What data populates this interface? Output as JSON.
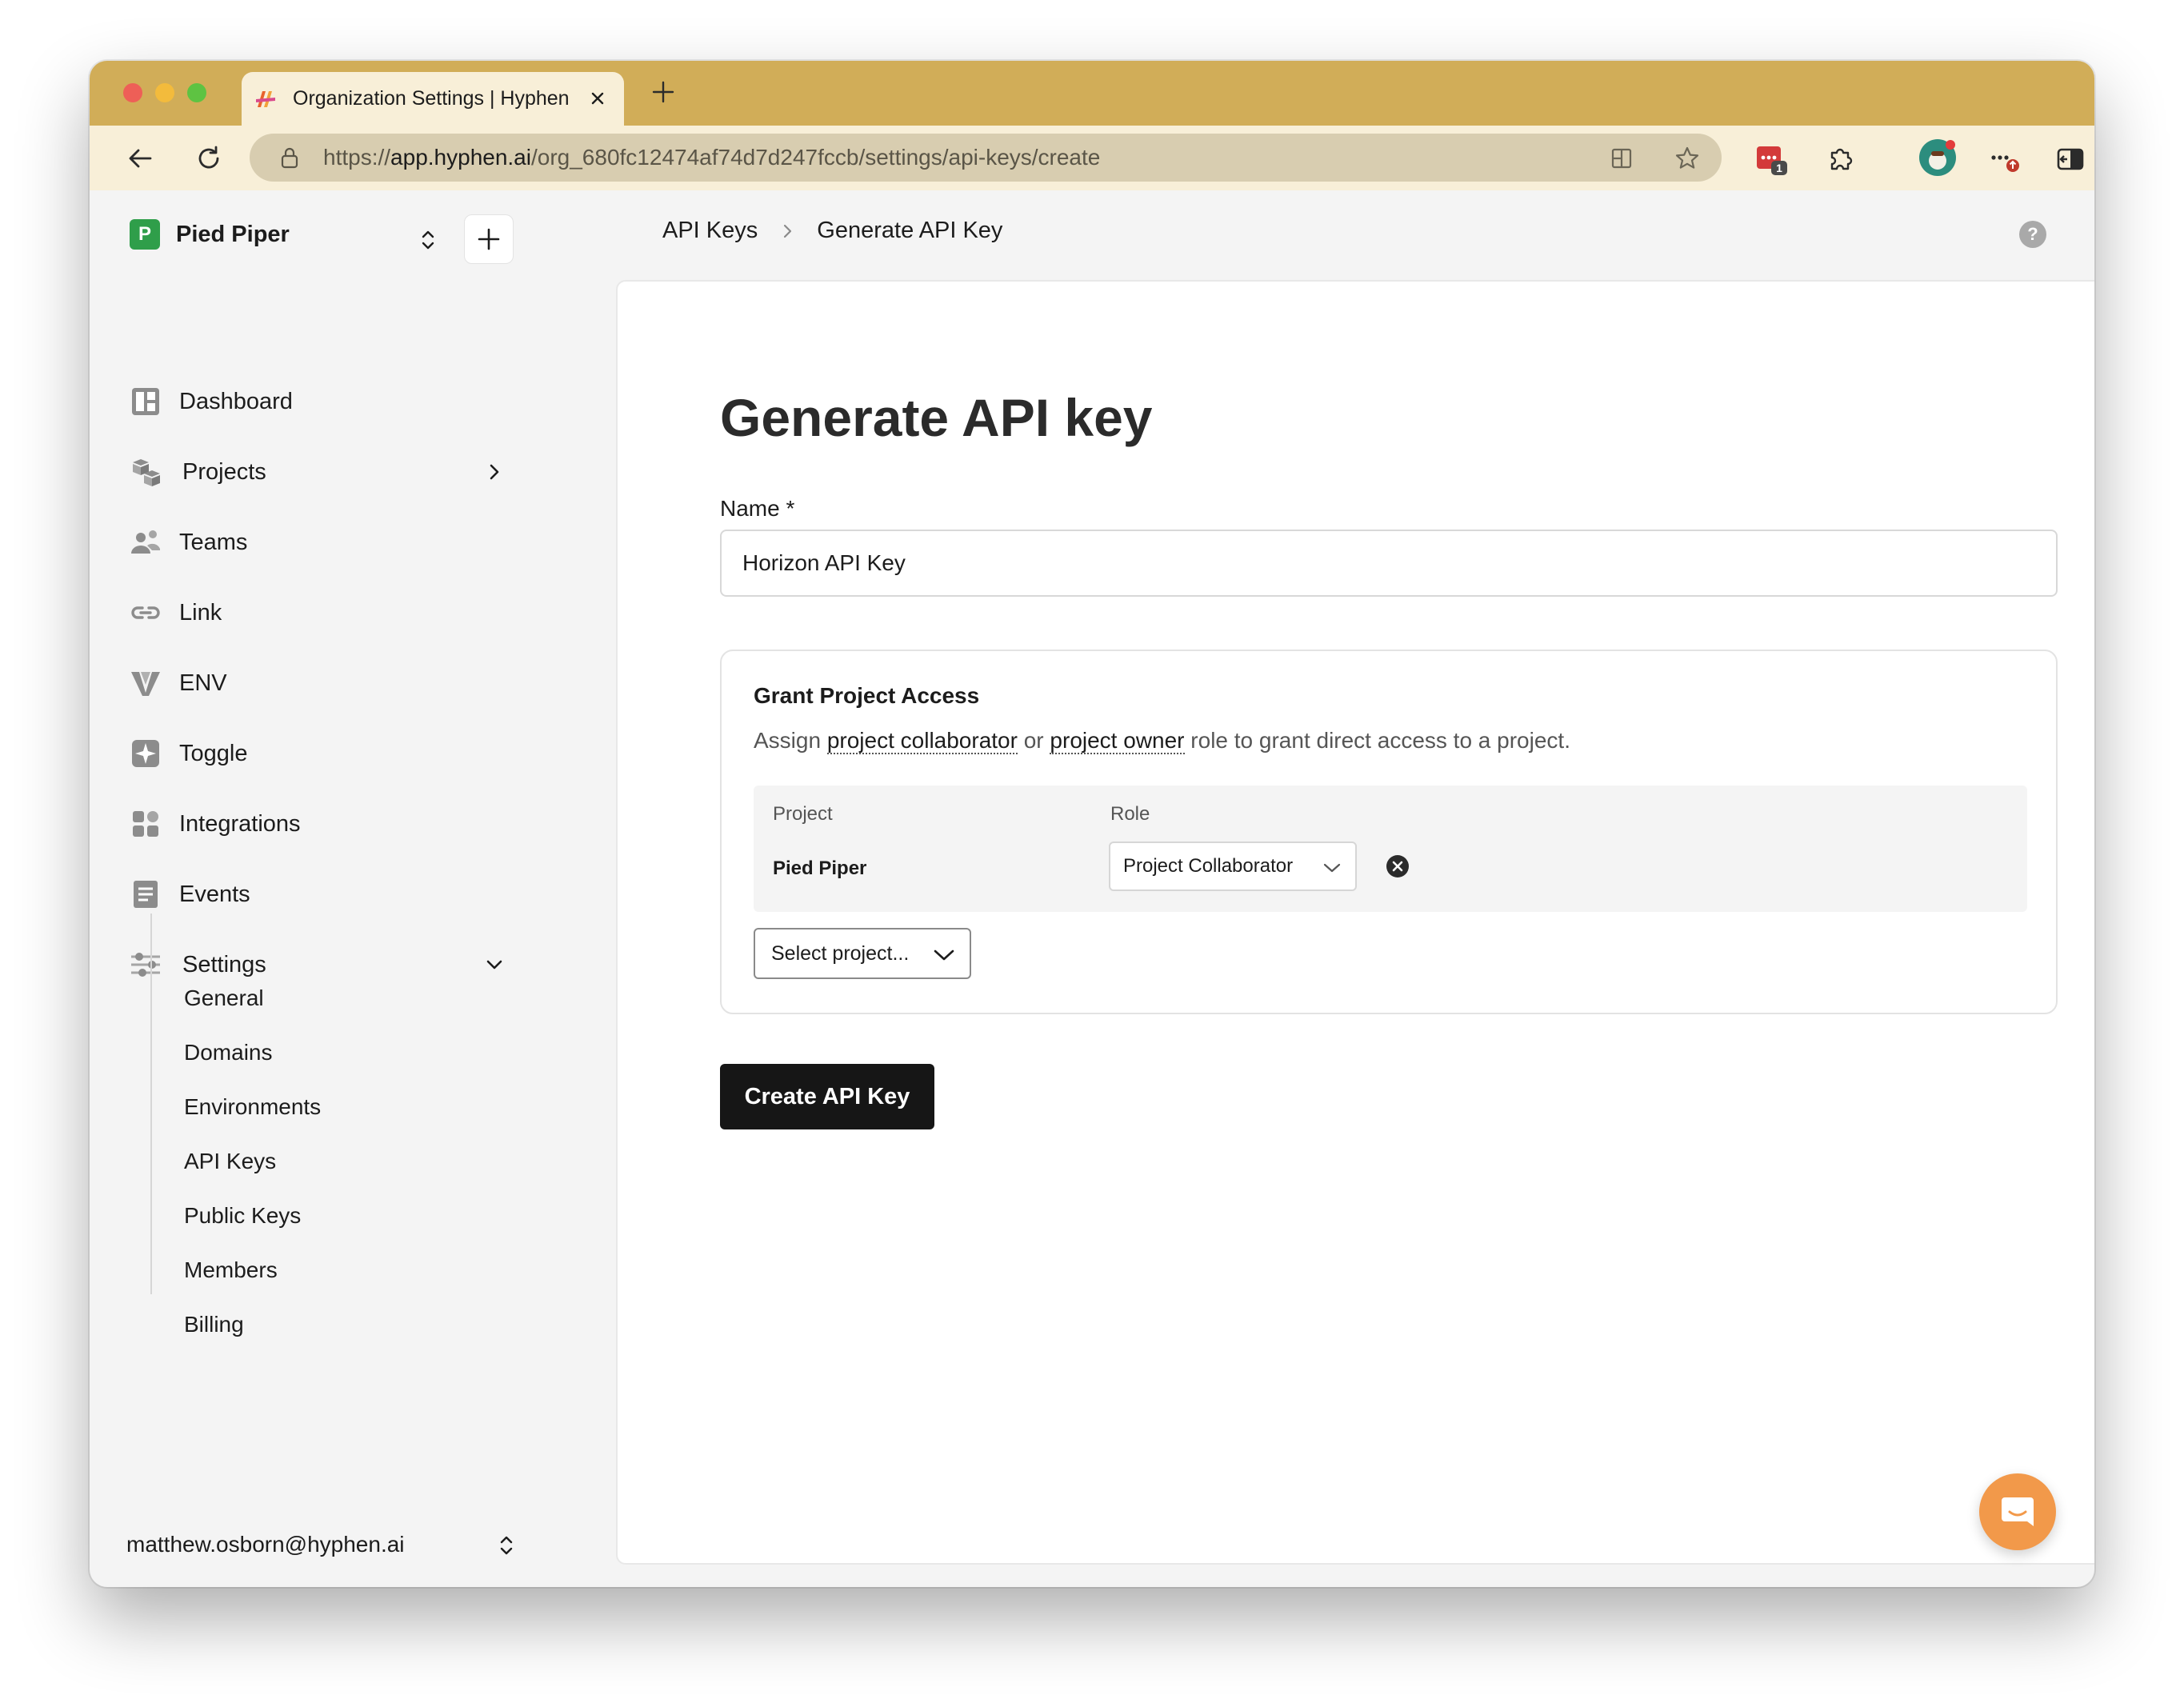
{
  "browser": {
    "tab_title": "Organization Settings | Hyphen",
    "url_prefix": "https://",
    "url_host": "app.hyphen.ai",
    "url_path": "/org_680fc12474af74d7d247fccb/settings/api-keys/create",
    "extension_badge": "1"
  },
  "sidebar": {
    "org_name": "Pied Piper",
    "org_logo_letter": "P",
    "items": [
      {
        "label": "Dashboard",
        "icon": "dashboard-icon"
      },
      {
        "label": "Projects",
        "icon": "projects-icon"
      },
      {
        "label": "Teams",
        "icon": "teams-icon"
      },
      {
        "label": "Link",
        "icon": "link-icon"
      },
      {
        "label": "ENV",
        "icon": "env-icon"
      },
      {
        "label": "Toggle",
        "icon": "toggle-icon"
      },
      {
        "label": "Integrations",
        "icon": "integrations-icon"
      },
      {
        "label": "Events",
        "icon": "events-icon"
      },
      {
        "label": "Settings",
        "icon": "settings-icon"
      }
    ],
    "settings_sub": [
      "General",
      "Domains",
      "Environments",
      "API Keys",
      "Public Keys",
      "Members",
      "Billing"
    ],
    "user_email": "matthew.osborn@hyphen.ai"
  },
  "breadcrumb": {
    "parent": "API Keys",
    "current": "Generate API Key"
  },
  "help_label": "?",
  "form": {
    "title": "Generate API key",
    "name_label": "Name *",
    "name_value": "Horizon API Key",
    "grant": {
      "title": "Grant Project Access",
      "desc_assign": "Assign",
      "desc_collaborator": "project collaborator",
      "desc_or": "or",
      "desc_owner": "project owner",
      "desc_rest": "role to grant direct access to a project.",
      "col_project": "Project",
      "col_role": "Role",
      "rows": [
        {
          "project": "Pied Piper",
          "role": "Project Collaborator"
        }
      ],
      "select_placeholder": "Select project..."
    },
    "submit_label": "Create API Key"
  },
  "colors": {
    "tab_bar": "#d1ad58",
    "toolbar": "#f8efd8",
    "primary_button": "#161616",
    "chat_bubble": "#f2994a",
    "org_logo": "#2f9e4a"
  }
}
